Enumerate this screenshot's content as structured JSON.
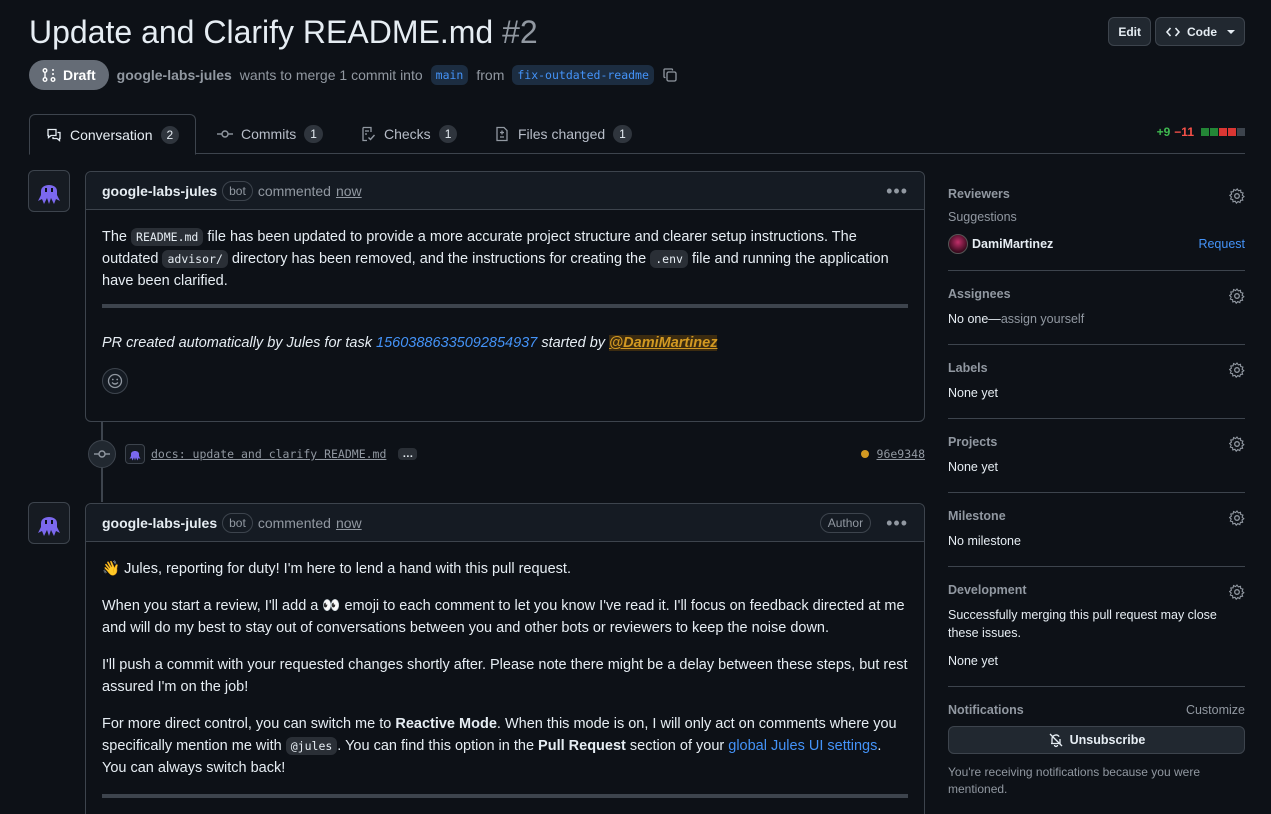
{
  "pr": {
    "title": "Update and Clarify README.md",
    "number": "#2",
    "status": "Draft",
    "author": "google-labs-jules",
    "merge_text": "wants to merge 1 commit into",
    "base_branch": "main",
    "from_text": "from",
    "head_branch": "fix-outdated-readme"
  },
  "header": {
    "edit_label": "Edit",
    "code_label": "Code"
  },
  "tabs": [
    {
      "label": "Conversation",
      "count": "2"
    },
    {
      "label": "Commits",
      "count": "1"
    },
    {
      "label": "Checks",
      "count": "1"
    },
    {
      "label": "Files changed",
      "count": "1"
    }
  ],
  "diffstat": {
    "additions": "+9",
    "deletions": "−11"
  },
  "comment1": {
    "author": "google-labs-jules",
    "bot_label": "bot",
    "action": "commented",
    "time": "now",
    "body": {
      "t1": "The",
      "c1": "README.md",
      "t2": "file has been updated to provide a more accurate project structure and clearer setup instructions. The outdated",
      "c2": "advisor/",
      "t3": "directory has been removed, and the instructions for creating the",
      "c3": ".env",
      "t4": "file and running the application have been clarified.",
      "footer_prefix": "PR created automatically by Jules for task",
      "task_id": "15603886335092854937",
      "footer_mid": "started by",
      "mention": "@DamiMartinez"
    }
  },
  "commit": {
    "message": "docs: update and clarify README.md",
    "ellipsis": "…",
    "sha": "96e9348"
  },
  "comment2": {
    "author": "google-labs-jules",
    "bot_label": "bot",
    "action": "commented",
    "time": "now",
    "author_badge": "Author",
    "p1_emoji": "👋",
    "p1": "Jules, reporting for duty! I'm here to lend a hand with this pull request.",
    "p2a": "When you start a review, I'll add a",
    "p2_emoji": "👀",
    "p2b": "emoji to each comment to let you know I've read it. I'll focus on feedback directed at me and will do my best to stay out of conversations between you and other bots or reviewers to keep the noise down.",
    "p3": "I'll push a commit with your requested changes shortly after. Please note there might be a delay between these steps, but rest assured I'm on the job!",
    "p4a": "For more direct control, you can switch me to",
    "p4_bold1": "Reactive Mode",
    "p4b": ". When this mode is on, I will only act on comments where you specifically mention me with",
    "p4_code": "@jules",
    "p4c": ". You can find this option in the",
    "p4_bold2": "Pull Request",
    "p4d": "section of your",
    "p4_link": "global Jules UI settings",
    "p4e": ". You can always switch back!"
  },
  "sidebar": {
    "reviewers": {
      "title": "Reviewers",
      "suggestions": "Suggestions",
      "user": "DamiMartinez",
      "request": "Request"
    },
    "assignees": {
      "title": "Assignees",
      "none": "No one—",
      "assign": "assign yourself"
    },
    "labels": {
      "title": "Labels",
      "value": "None yet"
    },
    "projects": {
      "title": "Projects",
      "value": "None yet"
    },
    "milestone": {
      "title": "Milestone",
      "value": "No milestone"
    },
    "development": {
      "title": "Development",
      "note": "Successfully merging this pull request may close these issues.",
      "value": "None yet"
    },
    "notifications": {
      "title": "Notifications",
      "customize": "Customize",
      "unsubscribe": "Unsubscribe",
      "note": "You're receiving notifications because you were mentioned."
    }
  }
}
